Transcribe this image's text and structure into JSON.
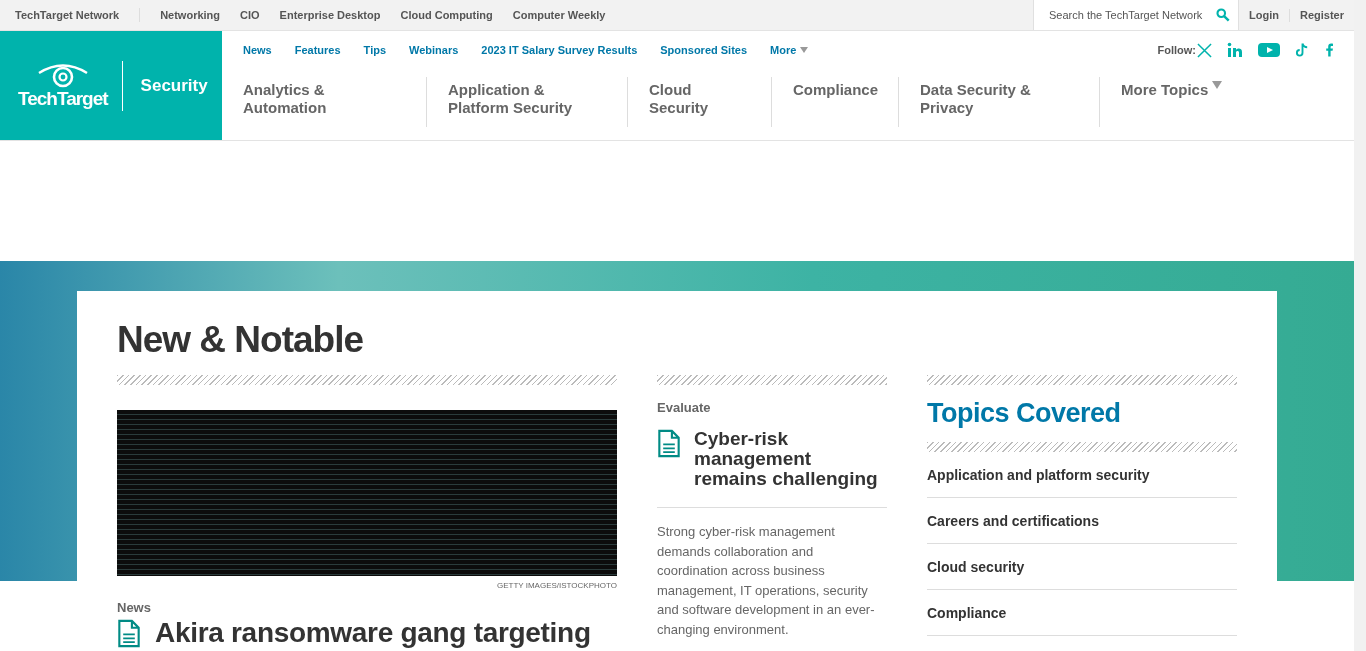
{
  "network_bar": {
    "brand": "TechTarget Network",
    "links": [
      "Networking",
      "CIO",
      "Enterprise Desktop",
      "Cloud Computing",
      "Computer Weekly"
    ],
    "search": {
      "placeholder": "Search the TechTarget Network"
    },
    "account": [
      "Login",
      "Register"
    ]
  },
  "header": {
    "logo": "TechTarget",
    "site": "Security",
    "nav": [
      {
        "label": "News",
        "dropdown": false
      },
      {
        "label": "Features",
        "dropdown": false
      },
      {
        "label": "Tips",
        "dropdown": false
      },
      {
        "label": "Webinars",
        "dropdown": false
      },
      {
        "label": "2023 IT Salary Survey Results",
        "dropdown": false
      },
      {
        "label": "Sponsored Sites",
        "dropdown": false
      },
      {
        "label": "More",
        "dropdown": true
      }
    ],
    "follow": "Follow:",
    "topics": [
      {
        "label": "Analytics & Automation",
        "dropdown": false
      },
      {
        "label": "Application & Platform Security",
        "dropdown": false
      },
      {
        "label": "Cloud Security",
        "dropdown": false
      },
      {
        "label": "Compliance",
        "dropdown": false
      },
      {
        "label": "Data Security & Privacy",
        "dropdown": false
      },
      {
        "label": "More Topics",
        "dropdown": true
      }
    ]
  },
  "notable": {
    "title": "New & Notable",
    "lead": {
      "credit": "GETTY IMAGES/ISTOCKPHOTO",
      "type": "News",
      "headline": "Akira ransomware gang targeting"
    },
    "feature": {
      "type": "Evaluate",
      "headline": "Cyber-risk management remains challenging",
      "summary": "Strong cyber-risk management demands collaboration and coordination across business management, IT operations, security and software development in an ever-changing environment."
    },
    "topics": {
      "title": "Topics Covered",
      "items": [
        "Application and platform security",
        "Careers and certifications",
        "Cloud security",
        "Compliance"
      ]
    }
  }
}
